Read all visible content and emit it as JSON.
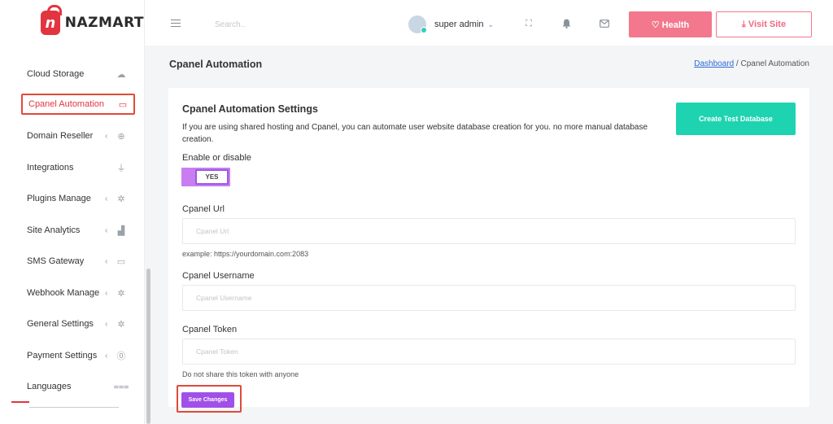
{
  "brand": {
    "name": "NAZMART",
    "logo_letter": "n"
  },
  "sidebar": {
    "items": [
      {
        "label": "Cloud Storage",
        "chevron": "",
        "icon": "cloud-icon",
        "glyph": "☁"
      },
      {
        "label": "Cpanel Automation",
        "chevron": "",
        "icon": "laptop-icon",
        "glyph": "▭",
        "active": true
      },
      {
        "label": "Domain Reseller",
        "chevron": "‹",
        "icon": "globe-icon",
        "glyph": "⊕"
      },
      {
        "label": "Integrations",
        "chevron": "",
        "icon": "plug-icon",
        "glyph": "⏚"
      },
      {
        "label": "Plugins Manage",
        "chevron": "‹",
        "icon": "cog-icon",
        "glyph": "✲"
      },
      {
        "label": "Site Analytics",
        "chevron": "‹",
        "icon": "bar-chart-icon",
        "glyph": "▟"
      },
      {
        "label": "SMS Gateway",
        "chevron": "‹",
        "icon": "laptop-icon",
        "glyph": "▭"
      },
      {
        "label": "Webhook Manage",
        "chevron": "‹",
        "icon": "cog-icon",
        "glyph": "✲"
      },
      {
        "label": "General Settings",
        "chevron": "‹",
        "icon": "cog-icon",
        "glyph": "✲"
      },
      {
        "label": "Payment Settings",
        "chevron": "‹",
        "icon": "dollar-circle-icon",
        "glyph": "⓪"
      },
      {
        "label": "Languages",
        "chevron": "",
        "icon": "language-icon",
        "glyph": "⩶"
      }
    ]
  },
  "header": {
    "search_placeholder": "Search..",
    "user_name": "super admin",
    "user_caret": "⌄",
    "health_label": "♡ Health",
    "visit_label": "⤓  Visit Site",
    "icons": {
      "fullscreen": "⛶",
      "bell": "🔔",
      "mail": "✉"
    }
  },
  "page": {
    "title": "Cpanel Automation",
    "breadcrumb_home": "Dashboard",
    "breadcrumb_sep": "/",
    "breadcrumb_current": "Cpanel Automation"
  },
  "card": {
    "title": "Cpanel Automation Settings",
    "description": "If you are using shared hosting and Cpanel, you can automate user website database creation for you. no more manual database creation.",
    "create_button": "Create Test Database",
    "toggle_label": "Enable or disable",
    "toggle_value": "YES",
    "url_label": "Cpanel Url",
    "url_placeholder": "Cpanel Url",
    "url_help": "example: https://yourdomain.com:2083",
    "username_label": "Cpanel Username",
    "username_placeholder": "Cpanel Username",
    "token_label": "Cpanel Token",
    "token_placeholder": "Cpanel Token",
    "token_help": "Do not share this token with anyone",
    "save_button": "Save Changes"
  }
}
